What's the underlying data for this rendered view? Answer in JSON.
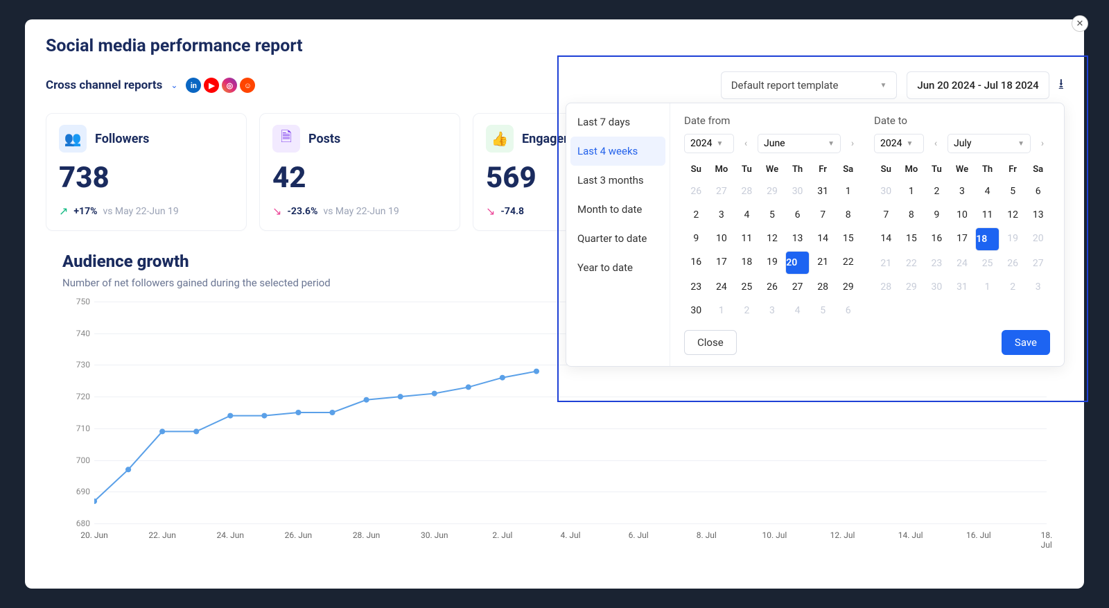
{
  "modal": {
    "title": "Social media performance report",
    "section": "Cross channel reports"
  },
  "toolbar": {
    "template_label": "Default report template",
    "date_range": "Jun 20 2024 - Jul 18 2024"
  },
  "kpi": {
    "followers": {
      "label": "Followers",
      "value": "738",
      "delta": "+17%",
      "context": "vs May 22-Jun 19",
      "dir": "up"
    },
    "posts": {
      "label": "Posts",
      "value": "42",
      "delta": "-23.6%",
      "context": "vs May 22-Jun 19",
      "dir": "down"
    },
    "engagement": {
      "label": "Engagement",
      "value": "569",
      "delta": "-74.8",
      "context": "",
      "dir": "down"
    }
  },
  "chart": {
    "title": "Audience growth",
    "subtitle": "Number of net followers gained during the selected period"
  },
  "chart_data": {
    "type": "line",
    "title": "Audience growth",
    "xlabel": "",
    "ylabel": "",
    "ylim": [
      680,
      750
    ],
    "y_ticks": [
      680,
      690,
      700,
      710,
      720,
      730,
      740,
      750
    ],
    "x_ticks": [
      "20. Jun",
      "22. Jun",
      "24. Jun",
      "26. Jun",
      "28. Jun",
      "30. Jun",
      "2. Jul",
      "4. Jul",
      "6. Jul",
      "8. Jul",
      "10. Jul",
      "12. Jul",
      "14. Jul",
      "16. Jul",
      "18. Jul"
    ],
    "series": [
      {
        "name": "Followers",
        "x": [
          "20. Jun",
          "21. Jun",
          "22. Jun",
          "23. Jun",
          "24. Jun",
          "25. Jun",
          "26. Jun",
          "27. Jun",
          "28. Jun",
          "29. Jun",
          "30. Jun",
          "1. Jul",
          "2. Jul",
          "3. Jul"
        ],
        "values": [
          687,
          697,
          709,
          709,
          714,
          714,
          715,
          715,
          719,
          720,
          721,
          723,
          726,
          728
        ]
      }
    ]
  },
  "date_picker": {
    "presets": [
      "Last 7 days",
      "Last 4 weeks",
      "Last 3 months",
      "Month to date",
      "Quarter to date",
      "Year to date"
    ],
    "active_preset": "Last 4 weeks",
    "from": {
      "label": "Date from",
      "year": "2024",
      "month": "June",
      "selected": 20,
      "dow": [
        "Su",
        "Mo",
        "Tu",
        "We",
        "Th",
        "Fr",
        "Sa"
      ],
      "grid": [
        [
          26,
          27,
          28,
          29,
          30,
          31,
          1
        ],
        [
          2,
          3,
          4,
          5,
          6,
          7,
          8
        ],
        [
          9,
          10,
          11,
          12,
          13,
          14,
          15
        ],
        [
          16,
          17,
          18,
          19,
          20,
          21,
          22
        ],
        [
          23,
          24,
          25,
          26,
          27,
          28,
          29
        ],
        [
          30,
          1,
          2,
          3,
          4,
          5,
          6
        ]
      ],
      "leading_muted": 5,
      "trailing_muted": 6
    },
    "to": {
      "label": "Date to",
      "year": "2024",
      "month": "July",
      "selected": 18,
      "dow": [
        "Su",
        "Mo",
        "Tu",
        "We",
        "Th",
        "Fr",
        "Sa"
      ],
      "grid": [
        [
          30,
          1,
          2,
          3,
          4,
          5,
          6
        ],
        [
          7,
          8,
          9,
          10,
          11,
          12,
          13
        ],
        [
          14,
          15,
          16,
          17,
          18,
          19,
          20
        ],
        [
          21,
          22,
          23,
          24,
          25,
          26,
          27
        ],
        [
          28,
          29,
          30,
          31,
          1,
          2,
          3
        ]
      ],
      "leading_muted": 1,
      "trailing_muted": 3,
      "muted_after_selected": true
    },
    "close": "Close",
    "save": "Save"
  }
}
